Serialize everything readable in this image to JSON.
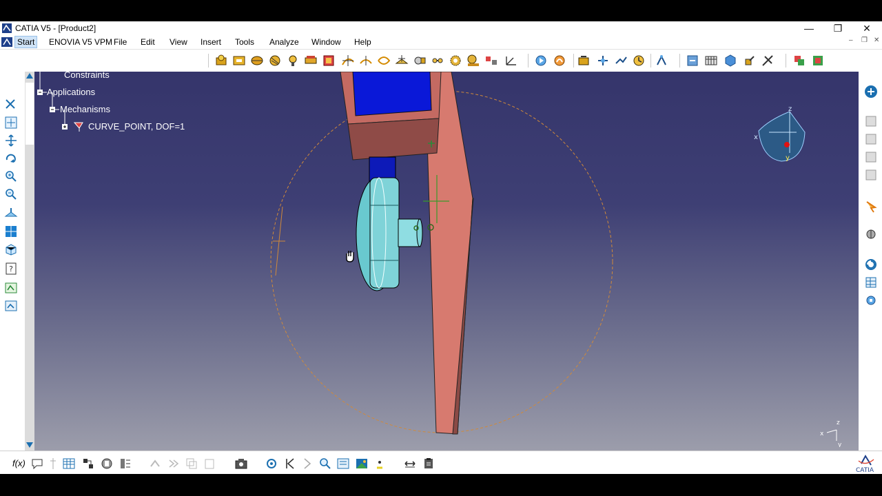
{
  "window": {
    "title": "CATIA V5 - [Product2]"
  },
  "menu": {
    "start": "Start",
    "items": [
      "ENOVIA V5 VPM",
      "File",
      "Edit",
      "View",
      "Insert",
      "Tools",
      "Analyze",
      "Window",
      "Help"
    ]
  },
  "tree": {
    "constraints": "Constraints",
    "applications": "Applications",
    "mechanisms": "Mechanisms",
    "mechanism": "CURVE_POINT, DOF=1"
  },
  "compass": {
    "x": "x",
    "y": "y",
    "z": "z"
  },
  "axis_triad": {
    "x": "x",
    "y": "y",
    "z": "z"
  },
  "bottom": {
    "formula": "f(x)"
  },
  "brand": {
    "name": "CATIA"
  },
  "colors": {
    "viewport_top": "#35356b",
    "viewport_bottom": "#9c9dab",
    "part_red": "#d77a6f",
    "part_cyan": "#7fd3d8",
    "part_blue": "#0a18d8",
    "trajectory": "#d18a3a"
  }
}
